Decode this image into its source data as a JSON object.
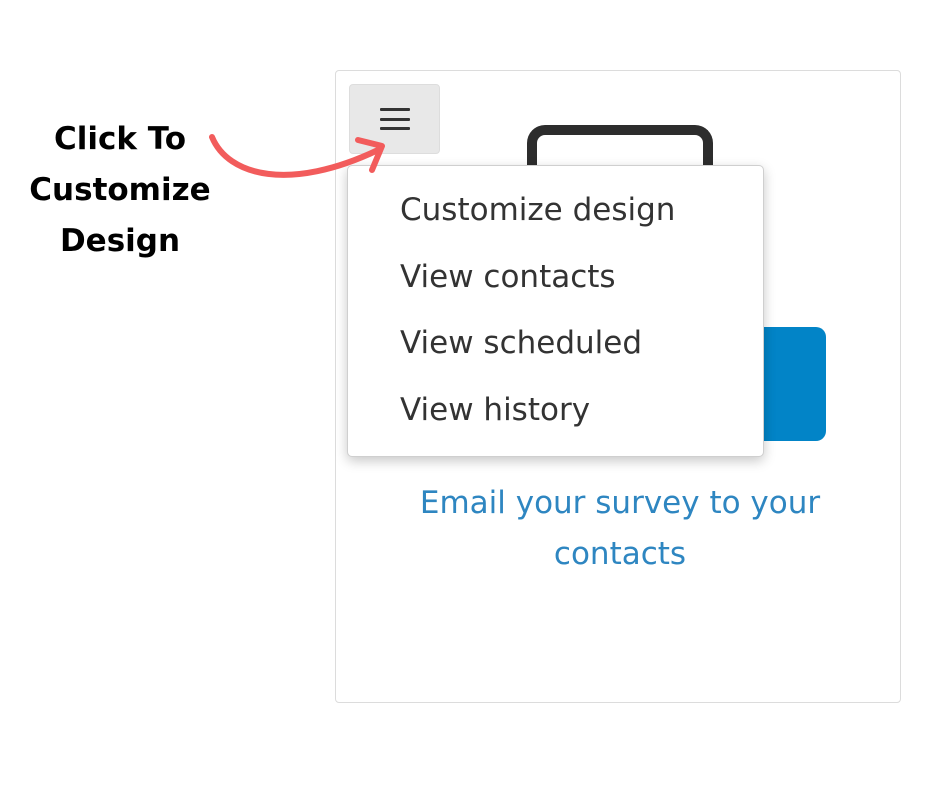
{
  "annotation": {
    "lines": [
      "Click To",
      "Customize",
      "Design"
    ],
    "arrow_color": "#f25c5c"
  },
  "card": {
    "menu_button_icon": "hamburger-icon",
    "device_icon": "device-icon",
    "email_button_color": "#0284c7",
    "caption_lines": [
      "Email your survey to your",
      "contacts"
    ]
  },
  "menu": {
    "items": [
      {
        "label": "Customize design"
      },
      {
        "label": "View contacts"
      },
      {
        "label": "View scheduled"
      },
      {
        "label": "View history"
      }
    ]
  }
}
